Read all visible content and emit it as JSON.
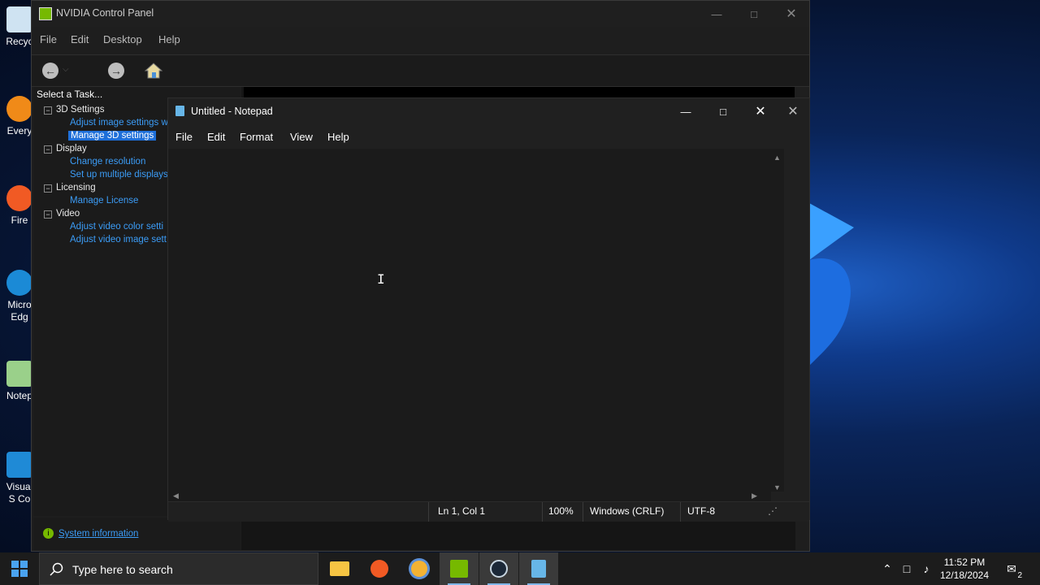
{
  "desktop": {
    "icons": [
      {
        "label": "Recyc",
        "icon": "recycle-bin-icon"
      },
      {
        "label": "Every",
        "icon": "everything-icon"
      },
      {
        "label": "Fire",
        "icon": "firefox-icon"
      },
      {
        "label": "Micro Edg",
        "icon": "edge-icon"
      },
      {
        "label": "Notep",
        "icon": "notepad-icon"
      },
      {
        "label": "Visual S Co",
        "icon": "vscode-icon"
      }
    ]
  },
  "nvidia": {
    "title": "NVIDIA Control Panel",
    "menu": [
      "File",
      "Edit",
      "Desktop",
      "Help"
    ],
    "task_header": "Select a Task...",
    "tree": {
      "cat1": "3D Settings",
      "item1": "Adjust image settings w",
      "item2": "Manage 3D settings",
      "cat2": "Display",
      "item3": "Change resolution",
      "item4": "Set up multiple displays",
      "cat3": "Licensing",
      "item5": "Manage License",
      "cat4": "Video",
      "item6": "Adjust video color setti",
      "item7": "Adjust video image sett"
    },
    "system_info_link": "System information"
  },
  "notepad": {
    "title": "Untitled - Notepad",
    "menu": [
      "File",
      "Edit",
      "Format",
      "View",
      "Help"
    ],
    "content": "",
    "status": {
      "position": "Ln 1, Col 1",
      "zoom": "100%",
      "line_ending": "Windows (CRLF)",
      "encoding": "UTF-8"
    }
  },
  "taskbar": {
    "search_placeholder": "Type here to search",
    "pinned": [
      "file-explorer-icon",
      "firefox-icon",
      "settings-sun-icon",
      "nvidia-icon",
      "steam-icon",
      "notepad-icon"
    ],
    "time": "11:52 PM",
    "date": "12/18/2024",
    "notification_count": "2"
  },
  "colors": {
    "nvidia_green": "#76b900",
    "link_blue": "#3b9cf6",
    "selection_blue": "#1e6fd9"
  }
}
